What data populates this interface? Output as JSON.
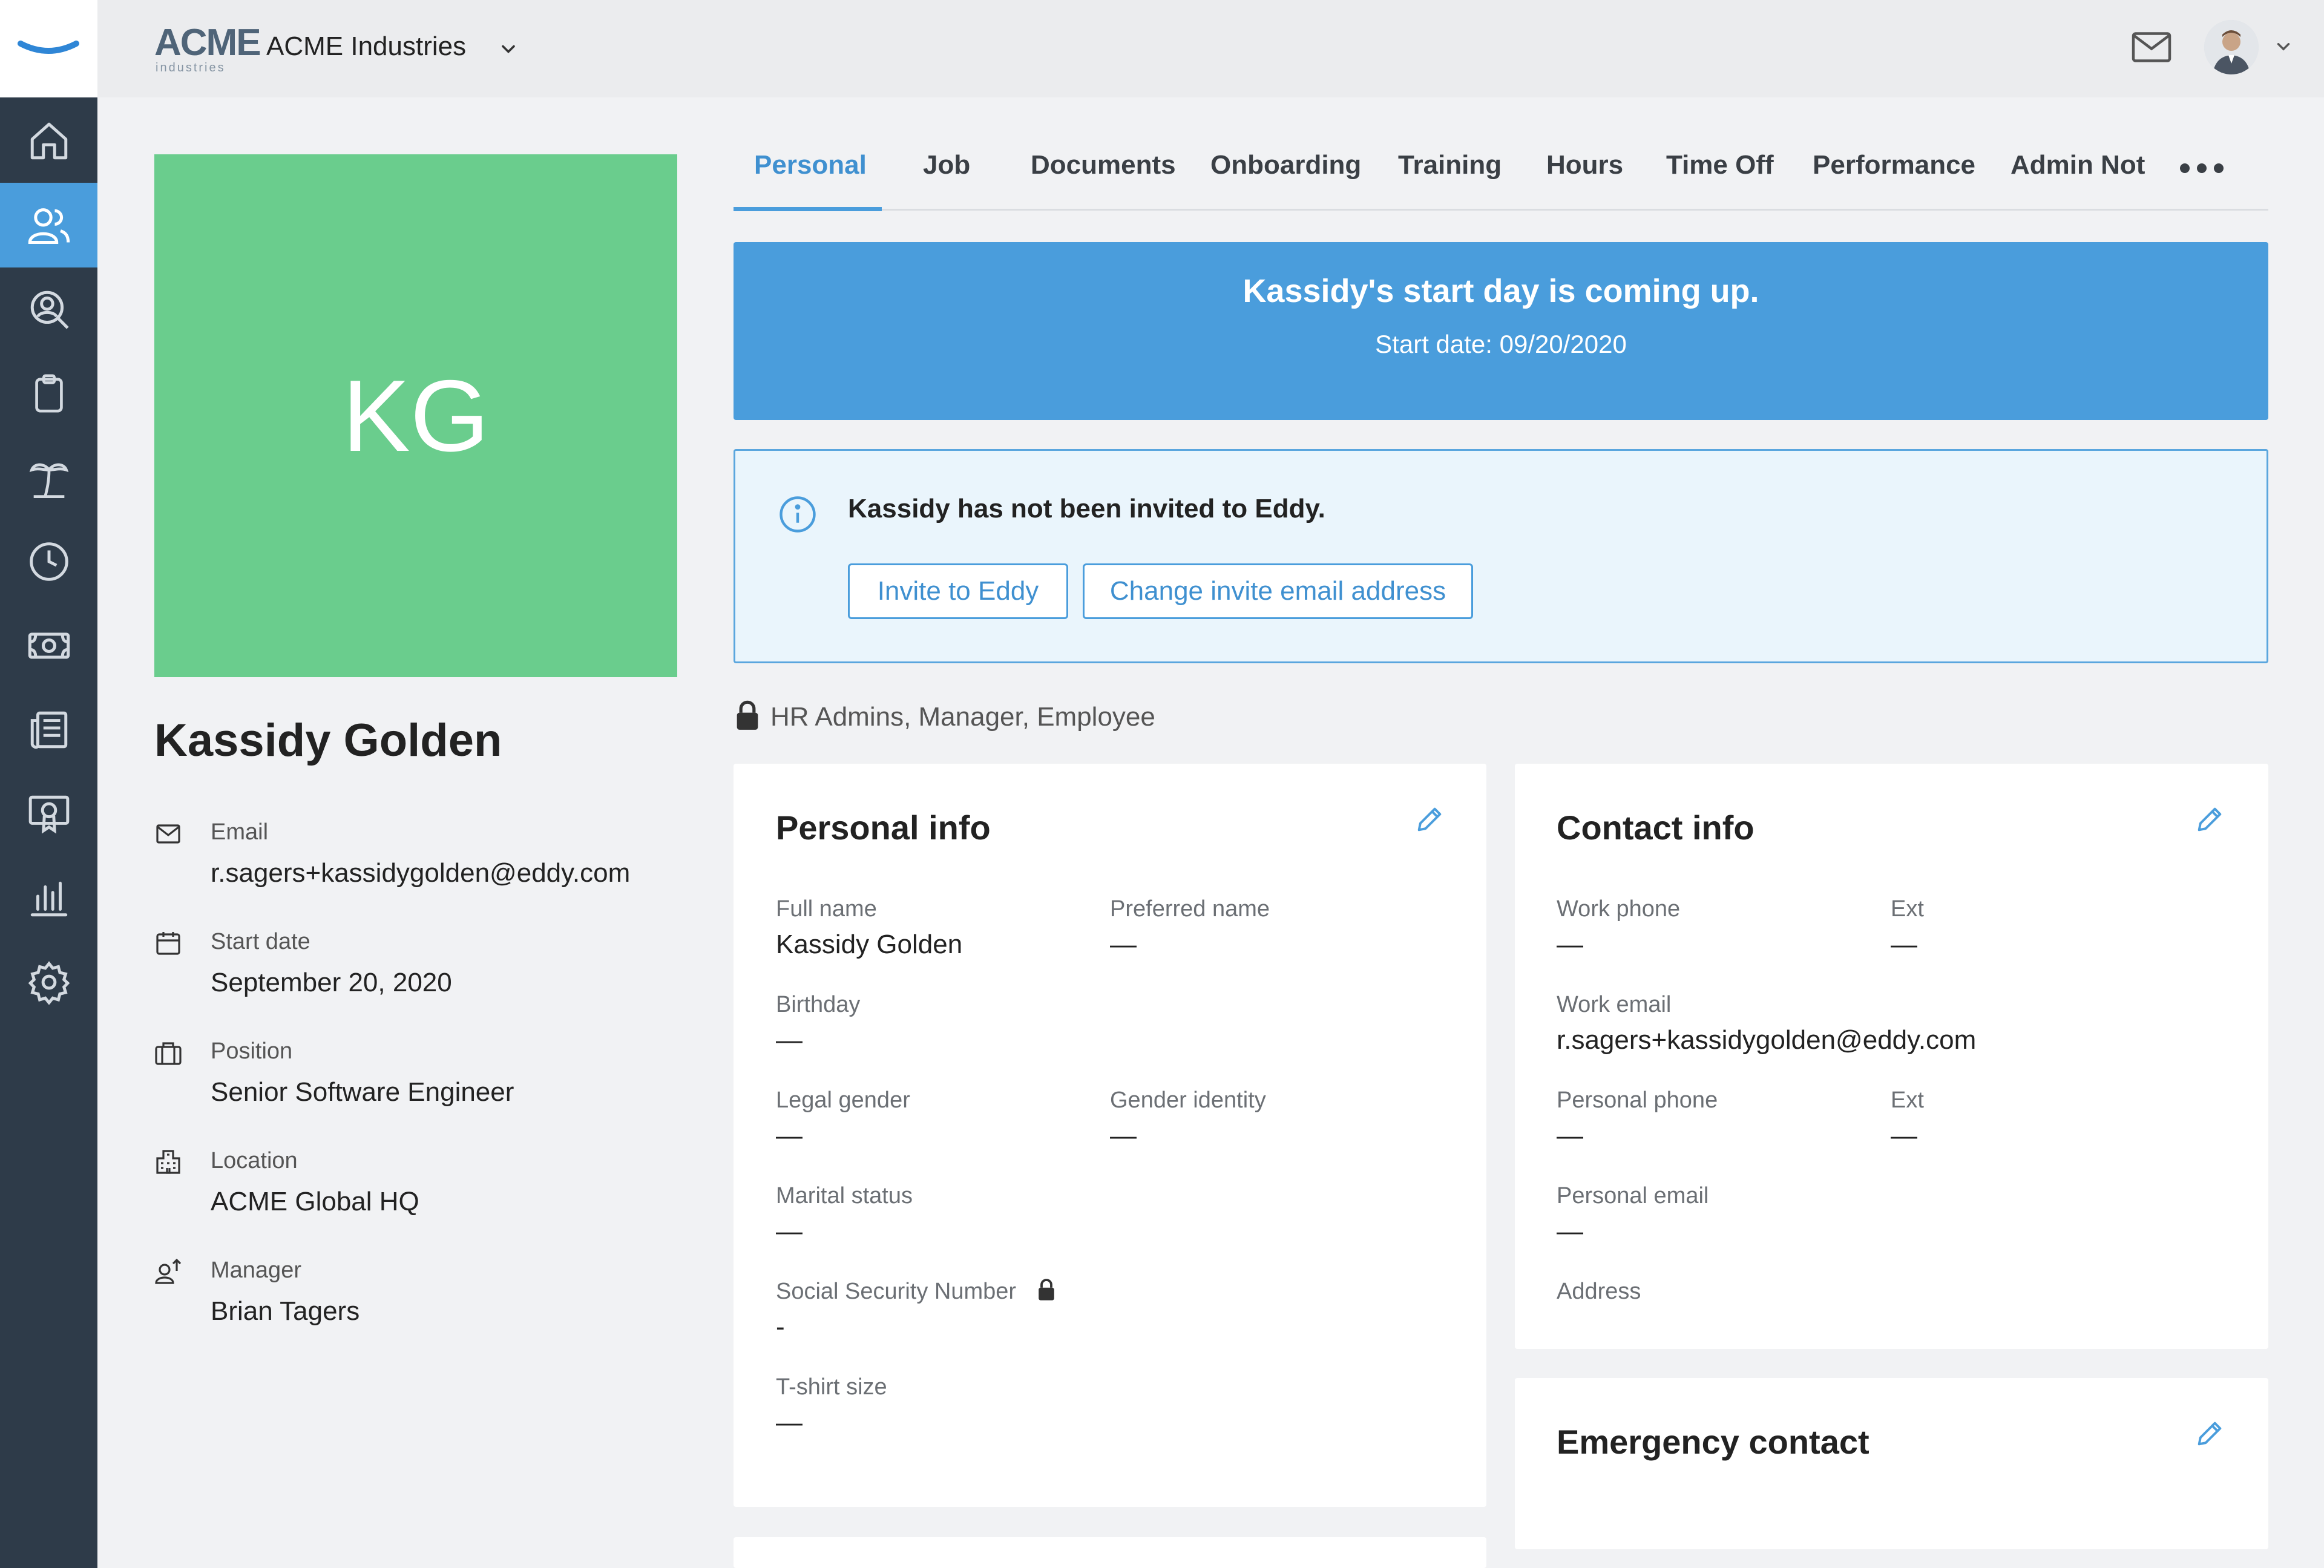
{
  "header": {
    "company_name": "ACME Industries",
    "logo_text": "ACME",
    "logo_subtext": "industries"
  },
  "tabs": [
    {
      "label": "Personal",
      "active": true
    },
    {
      "label": "Job"
    },
    {
      "label": "Documents"
    },
    {
      "label": "Onboarding"
    },
    {
      "label": "Training"
    },
    {
      "label": "Hours"
    },
    {
      "label": "Time Off"
    },
    {
      "label": "Performance"
    },
    {
      "label": "Admin Not"
    }
  ],
  "sidebar": {
    "items": [
      {
        "icon": "home-icon"
      },
      {
        "icon": "people-icon",
        "active": true
      },
      {
        "icon": "person-search-icon"
      },
      {
        "icon": "clipboard-icon"
      },
      {
        "icon": "palm-tree-icon"
      },
      {
        "icon": "clock-icon"
      },
      {
        "icon": "money-icon"
      },
      {
        "icon": "news-icon"
      },
      {
        "icon": "certificate-icon"
      },
      {
        "icon": "bar-chart-icon"
      },
      {
        "icon": "gear-icon"
      }
    ]
  },
  "profile": {
    "initials": "KG",
    "name": "Kassidy Golden",
    "email_label": "Email",
    "email": "r.sagers+kassidygolden@eddy.com",
    "start_date_label": "Start date",
    "start_date": "September 20, 2020",
    "position_label": "Position",
    "position": "Senior Software Engineer",
    "location_label": "Location",
    "location": "ACME Global HQ",
    "manager_label": "Manager",
    "manager": "Brian Tagers"
  },
  "start_banner": {
    "title": "Kassidy's start day is coming up.",
    "subtitle": "Start date: 09/20/2020"
  },
  "invite": {
    "message": "Kassidy has not been invited to Eddy.",
    "invite_button": "Invite to Eddy",
    "change_email_button": "Change invite email address"
  },
  "permissions": "HR Admins, Manager, Employee",
  "personal_info": {
    "title": "Personal info",
    "full_name_label": "Full name",
    "full_name": "Kassidy Golden",
    "preferred_name_label": "Preferred name",
    "preferred_name": "—",
    "birthday_label": "Birthday",
    "birthday": "—",
    "legal_gender_label": "Legal gender",
    "legal_gender": "—",
    "gender_identity_label": "Gender identity",
    "gender_identity": "—",
    "marital_status_label": "Marital status",
    "marital_status": "—",
    "ssn_label": "Social Security Number",
    "ssn": "-",
    "tshirt_label": "T-shirt size",
    "tshirt": "—"
  },
  "contact_info": {
    "title": "Contact info",
    "work_phone_label": "Work phone",
    "work_phone": "—",
    "work_ext_label": "Ext",
    "work_ext": "—",
    "work_email_label": "Work email",
    "work_email": "r.sagers+kassidygolden@eddy.com",
    "personal_phone_label": "Personal phone",
    "personal_phone": "—",
    "personal_ext_label": "Ext",
    "personal_ext": "—",
    "personal_email_label": "Personal email",
    "personal_email": "—",
    "address_label": "Address"
  },
  "emergency_contact": {
    "title": "Emergency contact"
  },
  "colors": {
    "sidebar": "#2e3b49",
    "accent": "#4a9ddc",
    "avatar": "#6acd8d"
  }
}
